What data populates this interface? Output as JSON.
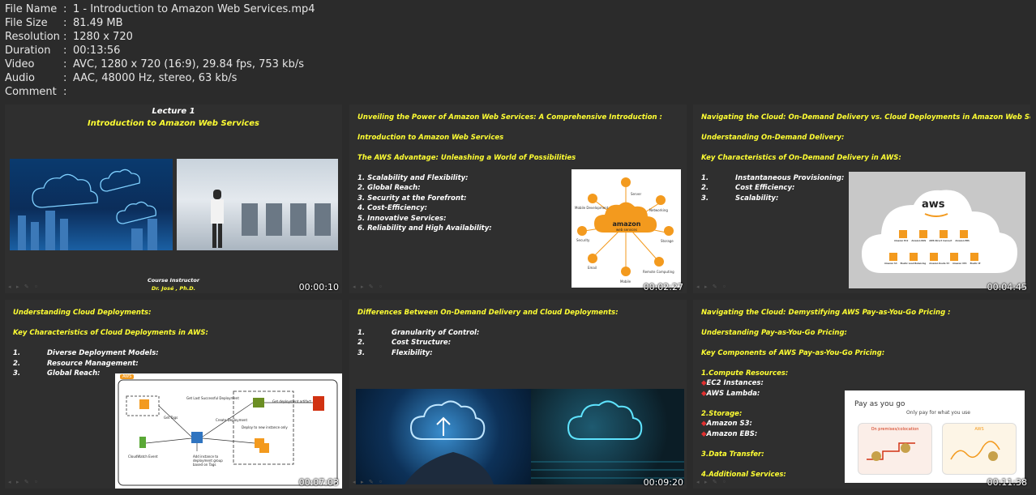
{
  "file_info": [
    {
      "key": "File Name",
      "value": "1 - Introduction to Amazon Web Services.mp4"
    },
    {
      "key": "File Size",
      "value": "81.49 MB"
    },
    {
      "key": "Resolution",
      "value": "1280 x 720"
    },
    {
      "key": "Duration",
      "value": "00:13:56"
    },
    {
      "key": "Video",
      "value": "AVC, 1280 x 720 (16:9), 29.84 fps, 753 kb/s"
    },
    {
      "key": "Audio",
      "value": "AAC, 48000 Hz, stereo, 63 kb/s"
    },
    {
      "key": "Comment",
      "value": ""
    }
  ],
  "separator": ":",
  "thumbs": {
    "t1": {
      "time": "00:00:10",
      "lecture": "Lecture 1",
      "title": "Introduction to Amazon Web Services",
      "instructor_label": "Course Instructor",
      "instructor_name": "Dr. José , Ph.D."
    },
    "t2": {
      "time": "00:02:27",
      "lines": [
        "Unveiling the Power of Amazon Web Services: A Comprehensive Introduction :",
        "Introduction to Amazon Web Services",
        "The AWS Advantage: Unleashing a World of Possibilities"
      ],
      "items": [
        "1. Scalability and Flexibility:",
        "2. Global Reach:",
        "3. Security at the Forefront:",
        "4. Cost-Efficiency:",
        "5. Innovative Services:",
        "6. Reliability and High Availability:"
      ],
      "diagram": {
        "center": "amazon",
        "center_sub": "web services",
        "nodes": [
          "Server",
          "Networking",
          "Storage",
          "Remote Computing",
          "Mobile",
          "Email",
          "Security",
          "Mobile Development"
        ]
      }
    },
    "t3": {
      "time": "00:04:45",
      "lines": [
        "Navigating the Cloud: On-Demand Delivery vs. Cloud Deployments in Amazon Web Services",
        "Understanding On-Demand Delivery:",
        "Key Characteristics of On-Demand Delivery in AWS:"
      ],
      "items": [
        {
          "n": "1.",
          "t": "Instantaneous Provisioning:"
        },
        {
          "n": "2.",
          "t": "Cost Efficiency:"
        },
        {
          "n": "3.",
          "t": "Scalability:"
        }
      ],
      "aws_logo": "aws",
      "services_row1": [
        "Amazon EC2",
        "Amazon RDS",
        "AWS Direct Connect",
        "Amazon EBS"
      ],
      "services_row2": [
        "Amazon S3",
        "Elastic Load Balancing",
        "Amazon Route 53",
        "Amazon VPC",
        "Elastic IP"
      ]
    },
    "t4": {
      "time": "00:07:03",
      "lines": [
        "Understanding Cloud Deployments:",
        "Key Characteristics of Cloud Deployments in AWS:"
      ],
      "items": [
        {
          "n": "1.",
          "t": "Diverse Deployment Models:"
        },
        {
          "n": "2.",
          "t": "Resource Management:"
        },
        {
          "n": "3.",
          "t": "Global Reach:"
        }
      ],
      "diagram": {
        "badge": "AWS",
        "labels": [
          "Get Last Successful Deployment",
          "Get deployment artifact",
          "Get Tags",
          "Create Deployment",
          "Deploy to new instance only",
          "CloudWatch Event",
          "Add instance to deployment group based on Tags"
        ]
      }
    },
    "t5": {
      "time": "00:09:20",
      "lines": [
        "Differences Between On-Demand Delivery and Cloud Deployments:"
      ],
      "items": [
        {
          "n": "1.",
          "t": "Granularity of Control:"
        },
        {
          "n": "2.",
          "t": "Cost Structure:"
        },
        {
          "n": "3.",
          "t": "Flexibility:"
        }
      ]
    },
    "t6": {
      "time": "00:11:38",
      "lines": [
        "Navigating the Cloud: Demystifying AWS Pay-as-You-Go Pricing :",
        "Understanding Pay-as-You-Go Pricing:",
        "Key Components of AWS Pay-as-You-Go Pricing:"
      ],
      "sections": [
        {
          "h": "1.Compute Resources:",
          "subs": [
            "EC2 Instances:",
            "AWS Lambda:"
          ]
        },
        {
          "h": "2.Storage:",
          "subs": [
            "Amazon S3:",
            "Amazon EBS:"
          ]
        },
        {
          "h": "3.Data Transfer:",
          "subs": []
        },
        {
          "h": "4.Additional Services:",
          "subs": []
        }
      ],
      "payg": {
        "title": "Pay as you go",
        "subtitle": "Only pay for what you use",
        "left": "On premises/colocation",
        "right": "AWS"
      }
    }
  }
}
